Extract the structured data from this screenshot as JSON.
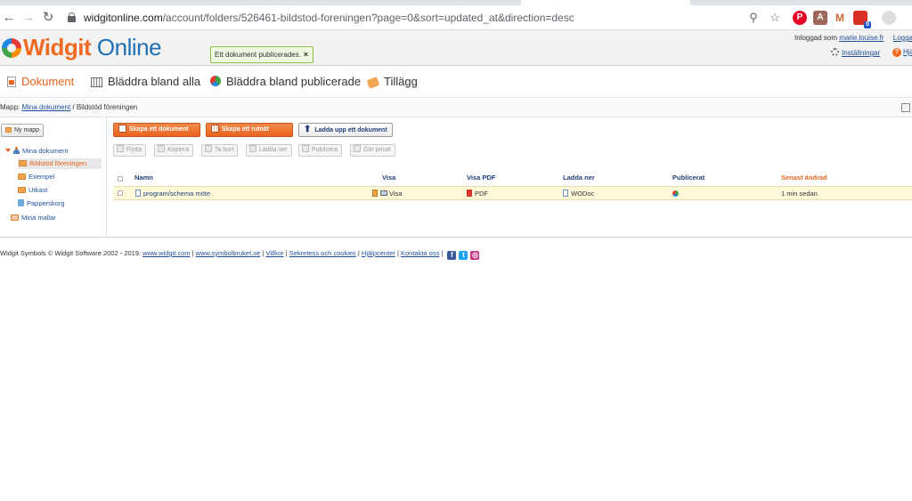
{
  "browser": {
    "url_host": "widgitonline.com",
    "url_path": "/account/folders/526461-bildstod-foreningen?page=0&sort=updated_at&direction=desc",
    "extension_badge": "0"
  },
  "header": {
    "logo_widgit": "Widgit",
    "logo_online": "Online",
    "toast": "Ett dokument publicerades.",
    "toast_close": "×",
    "login_prefix": "Inloggad som",
    "login_user": "marie.louise.fr",
    "logout": "Logga",
    "settings": "Inställningar",
    "help": "Hjä"
  },
  "nav": {
    "items": [
      {
        "label": "Dokument"
      },
      {
        "label": "Bläddra bland alla"
      },
      {
        "label": "Bläddra bland publicerade"
      },
      {
        "label": "Tillägg"
      }
    ]
  },
  "breadcrumb": {
    "prefix": "Mapp:",
    "root": "Mina dokument",
    "separator": " / ",
    "current": "Bildstöd föreningen"
  },
  "sidebar": {
    "new_folder": "Ny mapp",
    "tree": [
      {
        "label": "Mina dokument"
      },
      {
        "label": "Bildstöd föreningen"
      },
      {
        "label": "Exempel"
      },
      {
        "label": "Utkast"
      },
      {
        "label": "Papperskorg"
      },
      {
        "label": "Mina mallar"
      }
    ]
  },
  "toolbar": {
    "create_document": "Skapa ett dokument",
    "create_grid": "Skapa ett rutnät",
    "upload": "Ladda upp ett dokument",
    "move": "Flytta",
    "copy": "Kopiera",
    "delete": "Ta bort",
    "download": "Ladda ner",
    "publish": "Publicera",
    "make_private": "Gör privat"
  },
  "table": {
    "headers": {
      "name": "Namn",
      "view": "Visa",
      "view_pdf": "Visa PDF",
      "download": "Ladda ner",
      "published": "Publicerat",
      "modified": "Senast ändrad"
    },
    "rows": [
      {
        "name": "program/schema möte",
        "view": "Visa",
        "pdf": "PDF",
        "download": "WODoc",
        "modified": "1 min sedan"
      }
    ]
  },
  "footer": {
    "copyright": "Widgit Symbols © Widgit Software 2002 - 2019.",
    "links": [
      "www.widgit.com",
      "www.symbolbruket.se",
      "Villkor",
      "Sekretess och cookies",
      "Hjälpcenter",
      "Kontakta oss"
    ],
    "sep": " | "
  },
  "colors": {
    "accent_orange": "#e8641f",
    "link_blue": "#1f4f9c",
    "row_highlight": "#fdf9d8"
  }
}
